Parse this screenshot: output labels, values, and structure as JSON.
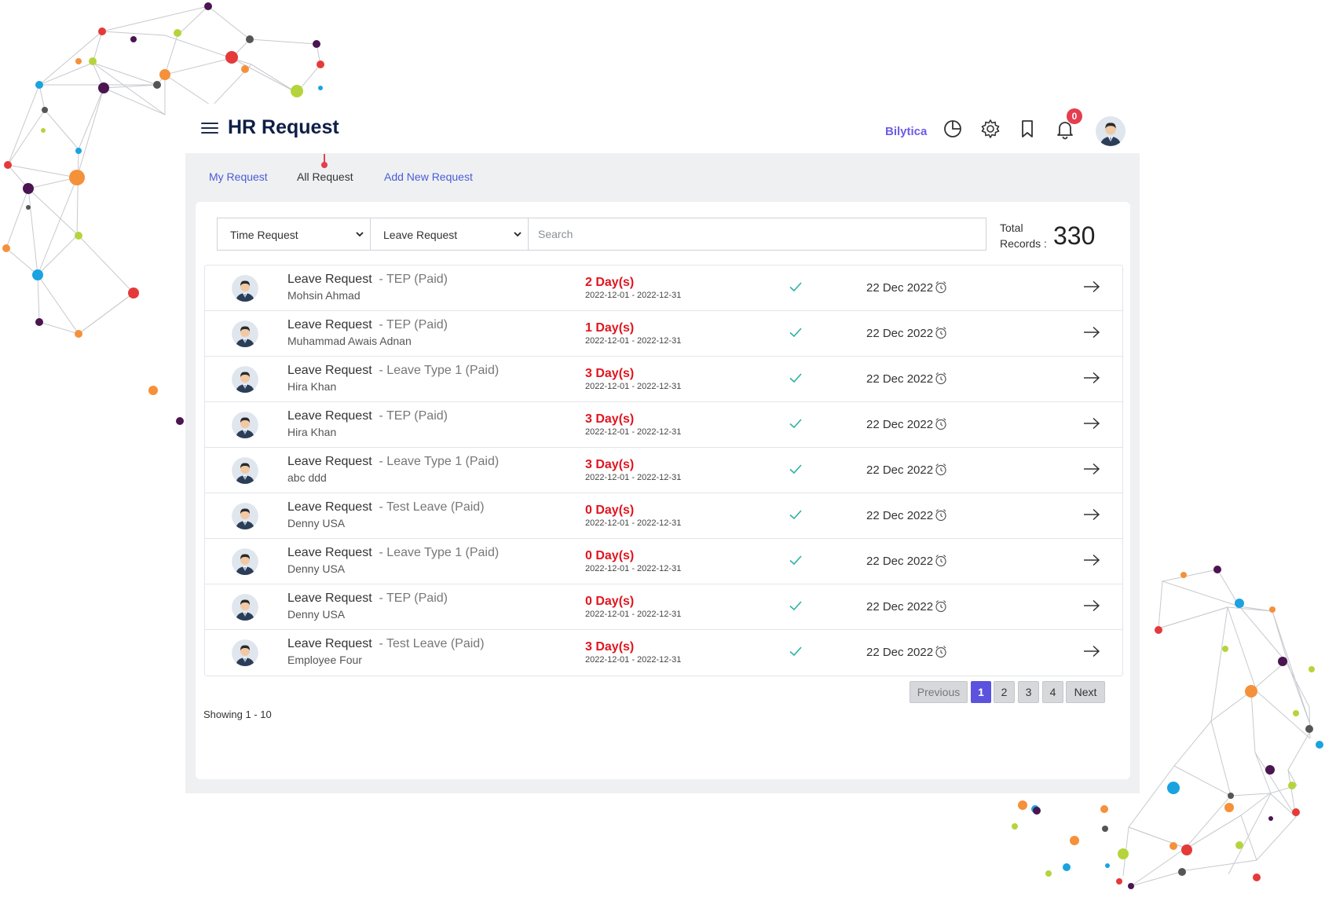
{
  "header": {
    "title": "HR Request",
    "brand": "Bilytica",
    "notification_count": "0",
    "icons": [
      "menu-icon",
      "pie-chart-icon",
      "gear-icon",
      "bookmark-icon",
      "bell-icon"
    ]
  },
  "tabs": [
    {
      "label": "My Request"
    },
    {
      "label": "All Request"
    },
    {
      "label": "Add New Request"
    }
  ],
  "filters": {
    "request_type": "Time Request",
    "leave_type": "Leave Request",
    "search_placeholder": "Search"
  },
  "total": {
    "label_line1": "Total",
    "label_line2": "Records :",
    "value": "330"
  },
  "rows": [
    {
      "title": "Leave Request",
      "type": "- TEP (Paid)",
      "name": "Mohsin Ahmad",
      "days": "2 Day(s)",
      "range": "2022-12-01 - 2022-12-31",
      "date": "22 Dec 2022"
    },
    {
      "title": "Leave Request",
      "type": "- TEP (Paid)",
      "name": "Muhammad Awais Adnan",
      "days": "1 Day(s)",
      "range": "2022-12-01 - 2022-12-31",
      "date": "22 Dec 2022"
    },
    {
      "title": "Leave Request",
      "type": "- Leave Type 1 (Paid)",
      "name": "Hira Khan",
      "days": "3 Day(s)",
      "range": "2022-12-01 - 2022-12-31",
      "date": "22 Dec 2022"
    },
    {
      "title": "Leave Request",
      "type": "- TEP (Paid)",
      "name": "Hira Khan",
      "days": "3 Day(s)",
      "range": "2022-12-01 - 2022-12-31",
      "date": "22 Dec 2022"
    },
    {
      "title": "Leave Request",
      "type": "- Leave Type 1 (Paid)",
      "name": "abc ddd",
      "days": "3 Day(s)",
      "range": "2022-12-01 - 2022-12-31",
      "date": "22 Dec 2022"
    },
    {
      "title": "Leave Request",
      "type": "- Test Leave (Paid)",
      "name": "Denny USA",
      "days": "0 Day(s)",
      "range": "2022-12-01 - 2022-12-31",
      "date": "22 Dec 2022"
    },
    {
      "title": "Leave Request",
      "type": "- Leave Type 1 (Paid)",
      "name": "Denny USA",
      "days": "0 Day(s)",
      "range": "2022-12-01 - 2022-12-31",
      "date": "22 Dec 2022"
    },
    {
      "title": "Leave Request",
      "type": "- TEP (Paid)",
      "name": "Denny USA",
      "days": "0 Day(s)",
      "range": "2022-12-01 - 2022-12-31",
      "date": "22 Dec 2022"
    },
    {
      "title": "Leave Request",
      "type": "- Test Leave (Paid)",
      "name": "Employee Four",
      "days": "3 Day(s)",
      "range": "2022-12-01 - 2022-12-31",
      "date": "22 Dec 2022"
    }
  ],
  "footer": {
    "showing": "Showing 1 - 10",
    "previous": "Previous",
    "pages": [
      "1",
      "2",
      "3",
      "4"
    ],
    "active_page": "1",
    "next": "Next"
  },
  "colors": {
    "accent": "#5b53de",
    "link": "#4b5cd6",
    "title": "#0f1e46",
    "days": "#e0151f",
    "check": "#2bb3a3",
    "badge": "#e53e4f"
  }
}
